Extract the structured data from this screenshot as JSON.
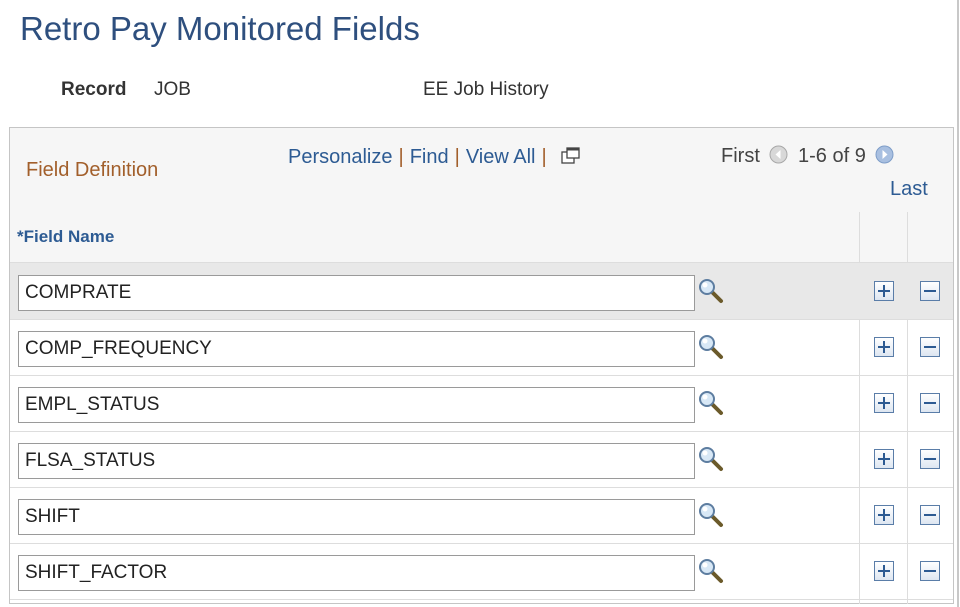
{
  "page": {
    "title": "Retro Pay Monitored Fields",
    "record_label": "Record",
    "record_value": "JOB",
    "record_description": "EE Job History"
  },
  "grid": {
    "title": "Field Definition",
    "links": {
      "personalize": "Personalize",
      "find": "Find",
      "view_all": "View All",
      "separator": "|"
    },
    "pager": {
      "first": "First",
      "range": "1-6 of 9",
      "last": "Last"
    },
    "column_header": "*Field Name",
    "rows": [
      {
        "field_name": "COMPRATE"
      },
      {
        "field_name": "COMP_FREQUENCY"
      },
      {
        "field_name": "EMPL_STATUS"
      },
      {
        "field_name": "FLSA_STATUS"
      },
      {
        "field_name": "SHIFT"
      },
      {
        "field_name": "SHIFT_FACTOR"
      }
    ]
  },
  "icons": {
    "lookup": "magnifying-glass-icon",
    "add_row": "plus-icon",
    "delete_row": "minus-icon",
    "previous": "left-arrow-circle-icon",
    "next": "right-arrow-circle-icon",
    "new_window": "new-window-icon"
  },
  "colors": {
    "title": "#2e4f7e",
    "link": "#2d5b93",
    "grid_title": "#a25f2b",
    "shaded_row": "#e8e8e8"
  }
}
